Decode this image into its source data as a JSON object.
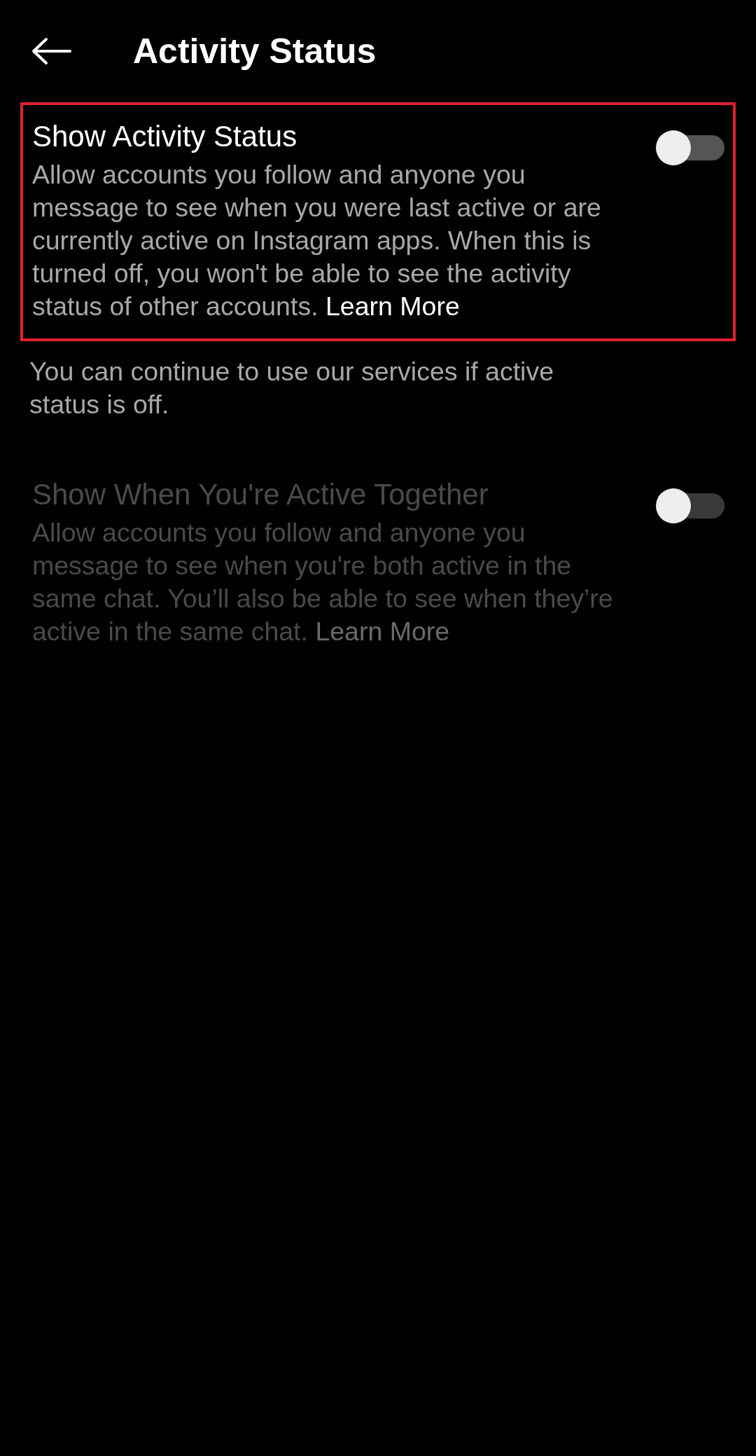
{
  "header": {
    "title": "Activity Status"
  },
  "settings": [
    {
      "title": "Show Activity Status",
      "description": "Allow accounts you follow and anyone you message to see when you were last active or are currently active on Instagram apps. When this is turned off, you won't be able to see the activity status of other accounts.",
      "link": "Learn More",
      "on": false,
      "disabled": false,
      "highlighted": true,
      "note": "You can continue to use our services if active status is off."
    },
    {
      "title": "Show When You're Active Together",
      "description": "Allow accounts you follow and anyone you message to see when you're both active in the same chat. You’ll also be able to see when they’re active in the same chat.",
      "link": "Learn More",
      "on": false,
      "disabled": true,
      "highlighted": false
    }
  ]
}
